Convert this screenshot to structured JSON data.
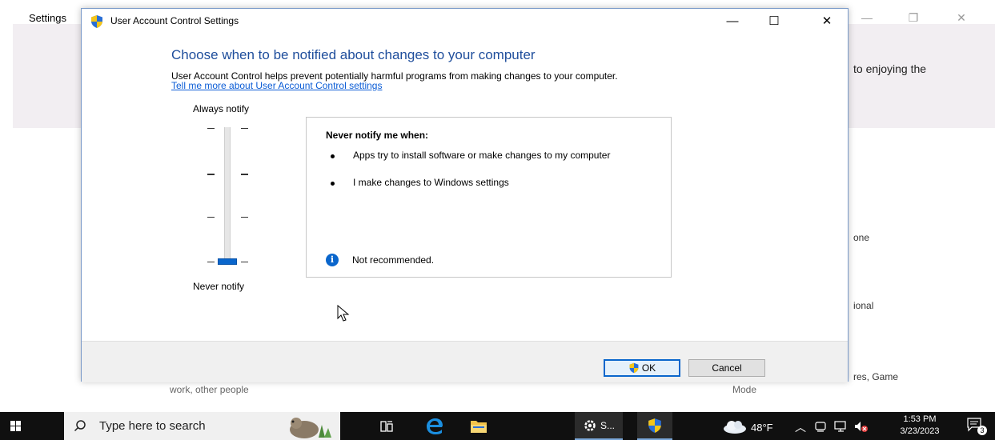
{
  "background": {
    "title": "Settings",
    "snippet_top_right": "to enjoying the",
    "snippet_one": "one",
    "snippet_ional": "ional",
    "snippet_res_game": "res, Game",
    "snippet_network": "work, other people",
    "snippet_mode": "Mode"
  },
  "dialog": {
    "title": "User Account Control Settings",
    "heading": "Choose when to be notified about changes to your computer",
    "description": "User Account Control helps prevent potentially harmful programs from making changes to your computer.",
    "link": "Tell me more about User Account Control settings",
    "slider": {
      "top_label": "Always notify",
      "bottom_label": "Never notify",
      "level_index": 0,
      "levels": 4
    },
    "info": {
      "heading": "Never notify me when:",
      "bullets": [
        "Apps try to install software or make changes to my computer",
        "I make changes to Windows settings"
      ],
      "note": "Not recommended."
    },
    "buttons": {
      "ok": "OK",
      "cancel": "Cancel"
    }
  },
  "taskbar": {
    "search_placeholder": "Type here to search",
    "settings_app_label": "S...",
    "weather": "48°F",
    "time": "1:53 PM",
    "date": "3/23/2023",
    "notification_count": "3"
  },
  "colors": {
    "accent": "#0a66cc",
    "heading": "#1f4e9c",
    "link": "#0a5cd6",
    "taskbar": "#101010"
  }
}
